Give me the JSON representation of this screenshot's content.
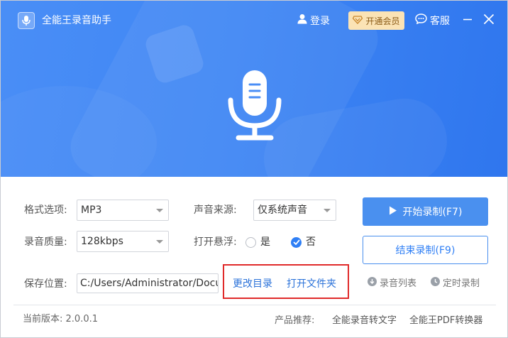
{
  "app": {
    "title": "全能王录音助手"
  },
  "header": {
    "login_label": "登录",
    "vip_label": "开通会员",
    "service_label": "客服"
  },
  "settings": {
    "format_label": "格式选项:",
    "format_value": "MP3",
    "quality_label": "录音质量:",
    "quality_value": "128kbps",
    "source_label": "声音来源:",
    "source_value": "仅系统声音",
    "float_label": "打开悬浮:",
    "float_options": [
      "是",
      "否"
    ],
    "float_selected": "否",
    "save_label": "保存位置:",
    "save_path": "C:/Users/Administrator/Documents",
    "change_dir_label": "更改目录",
    "open_folder_label": "打开文件夹"
  },
  "actions": {
    "start_label": "开始录制(F7)",
    "stop_label": "结束录制(F9)",
    "recordings_label": "录音列表",
    "timer_label": "定时录制"
  },
  "footer": {
    "version_label": "当前版本:",
    "version_value": "2.0.0.1",
    "recommend_label": "产品推荐:",
    "products": [
      "全能录音转文字",
      "全能王PDF转换器"
    ]
  },
  "colors": {
    "primary": "#3f86f4",
    "link": "#2b72d9",
    "highlight": "#e02a2a",
    "vip_bg": "#fbe3b5"
  }
}
